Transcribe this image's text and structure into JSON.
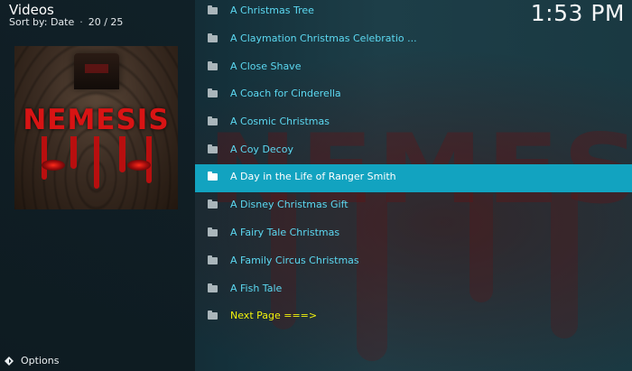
{
  "header": {
    "title": "Videos",
    "sort_label": "Sort by: Date",
    "separator": "·",
    "position": "20 / 25"
  },
  "clock": "1:53 PM",
  "poster": {
    "title": "NEMESIS"
  },
  "background": {
    "watermark": "NEMESIS"
  },
  "list": {
    "items": [
      {
        "label": "A Christmas Tree",
        "icon": "folder-icon"
      },
      {
        "label": "A Claymation Christmas Celebratio ...",
        "icon": "folder-icon"
      },
      {
        "label": "A Close Shave",
        "icon": "folder-icon"
      },
      {
        "label": "A Coach for Cinderella",
        "icon": "folder-icon"
      },
      {
        "label": "A Cosmic Christmas",
        "icon": "folder-icon"
      },
      {
        "label": "A Coy Decoy",
        "icon": "folder-icon"
      },
      {
        "label": "A Day in the Life of Ranger Smith",
        "icon": "folder-icon",
        "selected": true
      },
      {
        "label": "A Disney Christmas Gift",
        "icon": "folder-icon"
      },
      {
        "label": "A Fairy Tale Christmas",
        "icon": "folder-icon"
      },
      {
        "label": "A Family Circus Christmas",
        "icon": "folder-icon"
      },
      {
        "label": "A Fish Tale",
        "icon": "folder-icon"
      },
      {
        "label": "Next Page ===>",
        "icon": "folder-icon"
      }
    ]
  },
  "footer": {
    "options_label": "Options",
    "icon": "options-icon"
  },
  "colors": {
    "item_text": "#5cd9f2",
    "selected_bg": "#12a3c0",
    "next_page_text": "#f2f20c"
  }
}
